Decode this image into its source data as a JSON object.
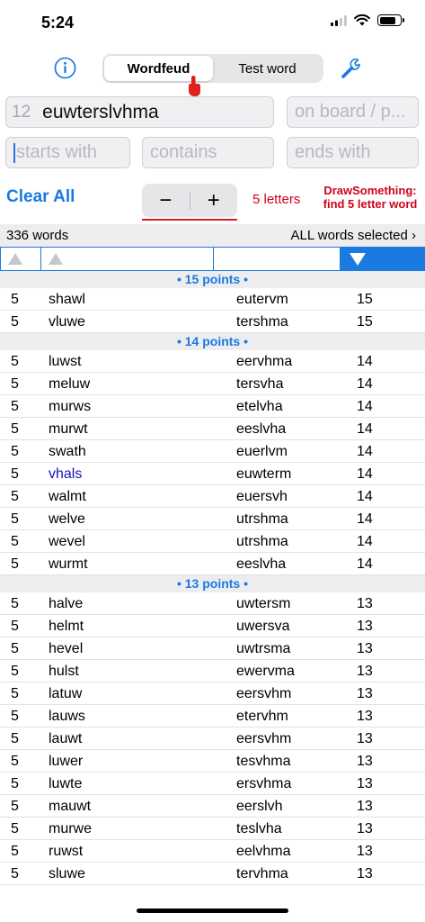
{
  "status": {
    "time": "5:24"
  },
  "toolbar": {
    "segments": [
      "Wordfeud",
      "Test word"
    ],
    "selected_segment": "Wordfeud",
    "info_icon": "info-circle-icon",
    "settings_icon": "wrench-icon"
  },
  "inputs": {
    "letter_count": "12",
    "letters": "euwterslvhma",
    "board_placeholder": "on board / p...",
    "starts_placeholder": "starts with",
    "contains_placeholder": "contains",
    "ends_placeholder": "ends with"
  },
  "controls": {
    "clear_label": "Clear All",
    "minus_label": "−",
    "plus_label": "+",
    "length_label": "5 letters",
    "hint_line1": "DrawSomething:",
    "hint_line2": "find 5 letter word"
  },
  "results": {
    "count_label": "336 words",
    "selection_label": "ALL words selected ›"
  },
  "sections": [
    {
      "title": "• 15 points •",
      "rows": [
        {
          "len": "5",
          "word": "shawl",
          "letters": "eutervm",
          "points": "15"
        },
        {
          "len": "5",
          "word": "vluwe",
          "letters": "tershma",
          "points": "15"
        }
      ]
    },
    {
      "title": "• 14 points •",
      "rows": [
        {
          "len": "5",
          "word": "luwst",
          "letters": "eervhma",
          "points": "14"
        },
        {
          "len": "5",
          "word": "meluw",
          "letters": "tersvha",
          "points": "14"
        },
        {
          "len": "5",
          "word": "murws",
          "letters": "etelvha",
          "points": "14"
        },
        {
          "len": "5",
          "word": "murwt",
          "letters": "eeslvha",
          "points": "14"
        },
        {
          "len": "5",
          "word": "swath",
          "letters": "euerlvm",
          "points": "14"
        },
        {
          "len": "5",
          "word": "vhals",
          "letters": "euwterm",
          "points": "14",
          "highlight": true
        },
        {
          "len": "5",
          "word": "walmt",
          "letters": "euersvh",
          "points": "14"
        },
        {
          "len": "5",
          "word": "welve",
          "letters": "utrshma",
          "points": "14"
        },
        {
          "len": "5",
          "word": "wevel",
          "letters": "utrshma",
          "points": "14"
        },
        {
          "len": "5",
          "word": "wurmt",
          "letters": "eeslvha",
          "points": "14"
        }
      ]
    },
    {
      "title": "• 13 points •",
      "rows": [
        {
          "len": "5",
          "word": "halve",
          "letters": "uwtersm",
          "points": "13"
        },
        {
          "len": "5",
          "word": "helmt",
          "letters": "uwersva",
          "points": "13"
        },
        {
          "len": "5",
          "word": "hevel",
          "letters": "uwtrsma",
          "points": "13"
        },
        {
          "len": "5",
          "word": "hulst",
          "letters": "ewervma",
          "points": "13"
        },
        {
          "len": "5",
          "word": "latuw",
          "letters": "eersvhm",
          "points": "13"
        },
        {
          "len": "5",
          "word": "lauws",
          "letters": "etervhm",
          "points": "13"
        },
        {
          "len": "5",
          "word": "lauwt",
          "letters": "eersvhm",
          "points": "13"
        },
        {
          "len": "5",
          "word": "luwer",
          "letters": "tesvhma",
          "points": "13"
        },
        {
          "len": "5",
          "word": "luwte",
          "letters": "ersvhma",
          "points": "13"
        },
        {
          "len": "5",
          "word": "mauwt",
          "letters": "eerslvh",
          "points": "13"
        },
        {
          "len": "5",
          "word": "murwe",
          "letters": "teslvha",
          "points": "13"
        },
        {
          "len": "5",
          "word": "ruwst",
          "letters": "eelvhma",
          "points": "13"
        },
        {
          "len": "5",
          "word": "sluwe",
          "letters": "tervhma",
          "points": "13"
        }
      ]
    }
  ],
  "colors": {
    "accent": "#1a7ae0",
    "red": "#d0021b",
    "highlight_word": "#1515b8"
  }
}
